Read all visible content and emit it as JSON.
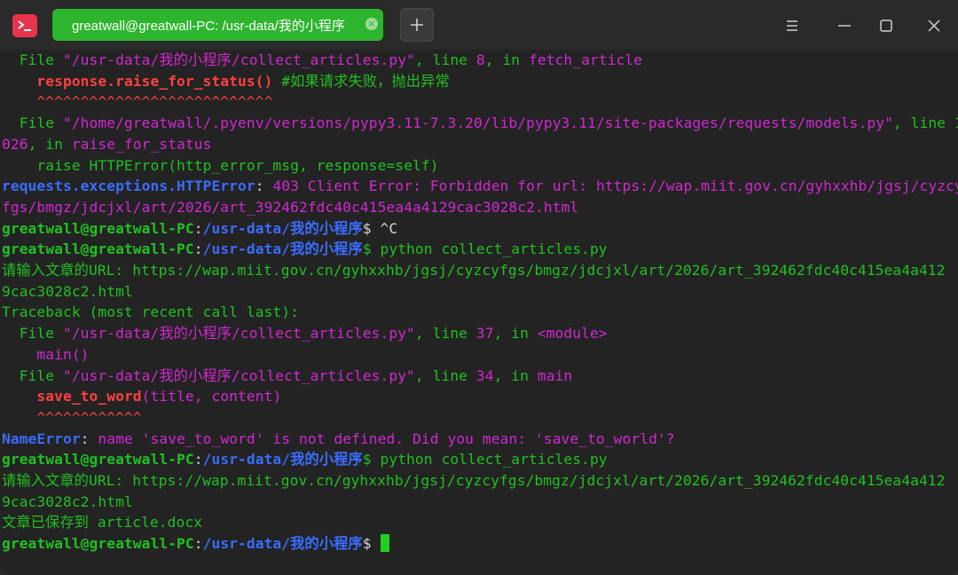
{
  "window": {
    "tab_title": "greatwall@greatwall-PC: /usr-data/我的小程序",
    "tab_close_icon": "close-icon",
    "new_tab_label": "+",
    "controls": [
      "menu-icon",
      "minimize-icon",
      "maximize-icon",
      "close-icon"
    ]
  },
  "colors": {
    "accent": "#2db52d",
    "app_icon": "#e8344e",
    "prompt_user": "#20c020",
    "prompt_path": "#3a6cff",
    "string": "#d028d0",
    "error": "#ff4040"
  },
  "terminal": {
    "l1": [
      "  File ",
      "\"/usr-data/我的小程序/collect_articles.py\"",
      ", line ",
      "8",
      ", in ",
      "fetch_article"
    ],
    "l2": [
      "    ",
      "response.raise_for_status()",
      " #如果请求失败，抛出异常"
    ],
    "l3": "    ^^^^^^^^^^^^^^^^^^^^^^^^^^^",
    "l4": [
      "  File ",
      "\"/home/greatwall/.pyenv/versions/pypy3.11-7.3.20/lib/pypy3.11/site-packages/requests/models.py\"",
      ", line 1"
    ],
    "l5": [
      "026",
      ", in ",
      "raise_for_status"
    ],
    "l6": "    raise HTTPError(http_error_msg, response=self)",
    "l7": [
      "requests.exceptions.HTTPError",
      ": ",
      "403 Client Error: Forbidden for url: https://wap.miit.gov.cn/gyhxxhb/jgsj/cyzcy"
    ],
    "l8": "fgs/bmgz/jdcjxl/art/2026/art_392462fdc40c415ea4a4129cac3028c2.html",
    "l9": [
      "greatwall@greatwall-PC",
      ":",
      "/usr-data/我的小程序",
      "$ ^C"
    ],
    "l10": [
      "greatwall@greatwall-PC",
      ":",
      "/usr-data/我的小程序",
      "$ python collect_articles.py"
    ],
    "l11": "请输入文章的URL: https://wap.miit.gov.cn/gyhxxhb/jgsj/cyzcyfgs/bmgz/jdcjxl/art/2026/art_392462fdc40c415ea4a412",
    "l12": "9cac3028c2.html",
    "l13": "Traceback (most recent call last):",
    "l14": [
      "  File ",
      "\"/usr-data/我的小程序/collect_articles.py\"",
      ", line ",
      "37",
      ", in ",
      "<module>"
    ],
    "l15": "    main()",
    "l16": [
      "  File ",
      "\"/usr-data/我的小程序/collect_articles.py\"",
      ", line ",
      "34",
      ", in ",
      "main"
    ],
    "l17": [
      "    ",
      "save_to_word",
      "(title, content)"
    ],
    "l18": "    ^^^^^^^^^^^^",
    "l19": [
      "NameError",
      ": ",
      "name 'save_to_word' is not defined. Did you mean: 'save_to_world'?"
    ],
    "l20": [
      "greatwall@greatwall-PC",
      ":",
      "/usr-data/我的小程序",
      "$ python collect_articles.py"
    ],
    "l21": "请输入文章的URL: https://wap.miit.gov.cn/gyhxxhb/jgsj/cyzcyfgs/bmgz/jdcjxl/art/2026/art_392462fdc40c415ea4a412",
    "l22": "9cac3028c2.html",
    "l23": "文章已保存到 article.docx",
    "l24": [
      "greatwall@greatwall-PC",
      ":",
      "/usr-data/我的小程序",
      "$ "
    ]
  }
}
